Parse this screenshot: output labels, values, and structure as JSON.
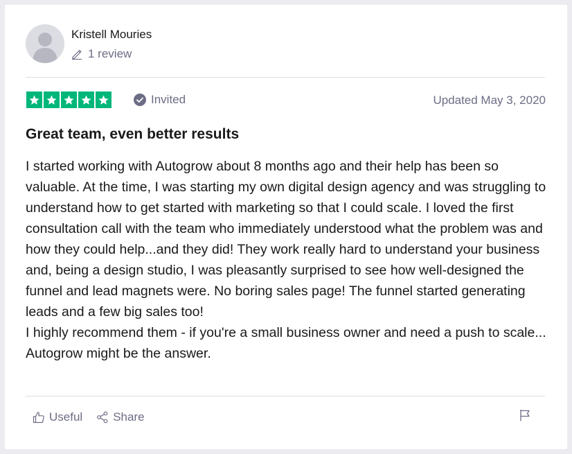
{
  "review": {
    "author": {
      "name": "Kristell Mouries",
      "review_count": "1 review",
      "avatar_icon": "user-silhouette-icon"
    },
    "rating": {
      "stars": 5,
      "max": 5,
      "color": "#00b67a"
    },
    "badge": {
      "label": "Invited",
      "icon": "check-circle-icon"
    },
    "date": "Updated May 3, 2020",
    "title": "Great team, even better results",
    "paragraphs": [
      "I started working with Autogrow about 8 months ago and their help has been so valuable. At the time, I was starting my own digital design agency and was struggling to understand how to get started with marketing so that I could scale. I loved the first consultation call with the team who immediately understood what the problem was and how they could help...and they did! They work really hard to understand your business and, being a design studio, I was pleasantly surprised to see how well-designed the funnel and lead magnets were. No boring sales page! The funnel started generating leads and a few big sales too!",
      "I highly recommend them - if you're a small business owner and need a push to scale... Autogrow might be the answer."
    ]
  },
  "actions": {
    "useful_label": "Useful",
    "share_label": "Share",
    "flag_icon": "flag-icon"
  }
}
